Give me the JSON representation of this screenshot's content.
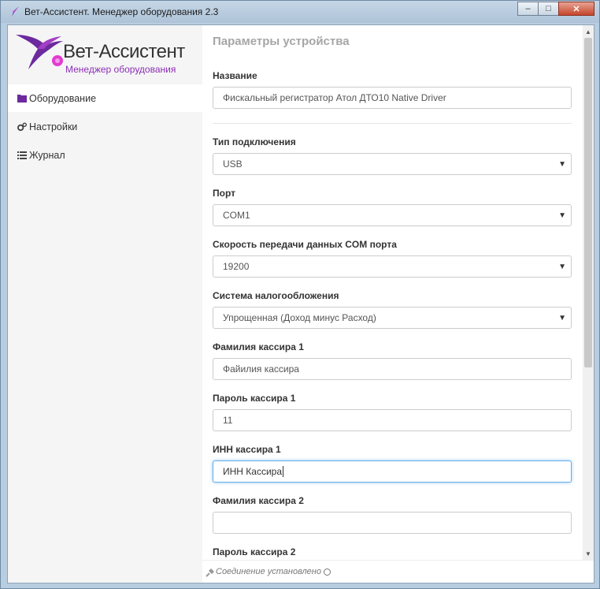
{
  "window": {
    "title": "Вет-Ассистент. Менеджер оборудования 2.3",
    "buttons": {
      "minimize": "–",
      "maximize": "□",
      "close": "✕"
    }
  },
  "logo": {
    "title": "Вет-Ассистент",
    "subtitle": "Менеджер оборудования"
  },
  "sidebar": {
    "items": [
      {
        "label": "Оборудование",
        "icon": "folder-icon",
        "active": true
      },
      {
        "label": "Настройки",
        "icon": "gears-icon",
        "active": false
      },
      {
        "label": "Журнал",
        "icon": "list-icon",
        "active": false
      }
    ]
  },
  "form": {
    "section_title": "Параметры устройства",
    "name_label": "Название",
    "name_value": "Фискальный регистратор Атол ДТО10 Native Driver",
    "connection_label": "Тип подключения",
    "connection_value": "USB",
    "port_label": "Порт",
    "port_value": "COM1",
    "speed_label": "Скорость передачи данных COM порта",
    "speed_value": "19200",
    "tax_label": "Система налогообложения",
    "tax_value": "Упрощенная (Доход минус Расход)",
    "cashier1_name_label": "Фамилия кассира 1",
    "cashier1_name_value": "Файилия кассира",
    "cashier1_pass_label": "Пароль кассира 1",
    "cashier1_pass_value": "11",
    "cashier1_inn_label": "ИНН кассира 1",
    "cashier1_inn_value": "ИНН Кассира",
    "cashier2_name_label": "Фамилия кассира 2",
    "cashier2_name_value": "",
    "cashier2_pass_label": "Пароль кассира 2"
  },
  "status": {
    "text": "Соединение установлено"
  },
  "colors": {
    "accent": "#8b2fb6",
    "focus": "#66afe9"
  }
}
